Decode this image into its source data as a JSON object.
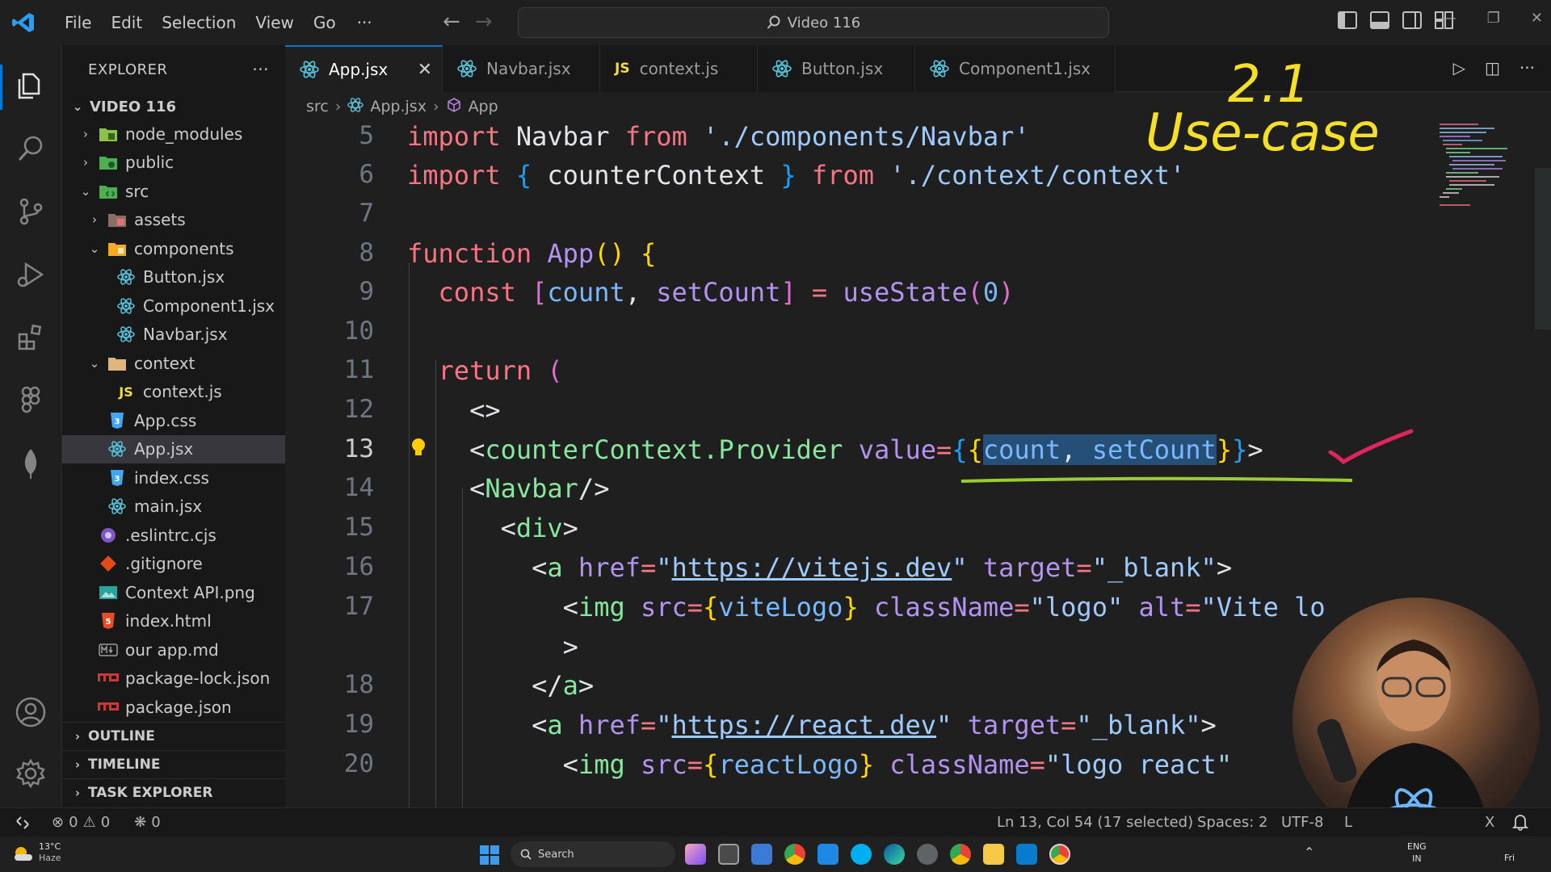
{
  "titlebar": {
    "menus": [
      "File",
      "Edit",
      "Selection",
      "View",
      "Go"
    ],
    "more": "···",
    "search_text": "Video 116"
  },
  "explorer": {
    "header": "EXPLORER",
    "more": "···",
    "root": "VIDEO 116",
    "items": [
      {
        "label": "node_modules",
        "icon": "folder-node-icon",
        "chev": "right"
      },
      {
        "label": "public",
        "icon": "folder-public-icon",
        "chev": "right"
      },
      {
        "label": "src",
        "icon": "folder-src-icon",
        "chev": "down"
      },
      {
        "label": "assets",
        "icon": "folder-assets-icon",
        "chev": "right"
      },
      {
        "label": "components",
        "icon": "folder-components-icon",
        "chev": "down"
      },
      {
        "label": "Button.jsx",
        "icon": "react-icon"
      },
      {
        "label": "Component1.jsx",
        "icon": "react-icon"
      },
      {
        "label": "Navbar.jsx",
        "icon": "react-icon"
      },
      {
        "label": "context",
        "icon": "folder-icon",
        "chev": "down"
      },
      {
        "label": "context.js",
        "icon": "js-icon"
      },
      {
        "label": "App.css",
        "icon": "css-icon"
      },
      {
        "label": "App.jsx",
        "icon": "react-icon",
        "selected": true
      },
      {
        "label": "index.css",
        "icon": "css-icon"
      },
      {
        "label": "main.jsx",
        "icon": "react-icon"
      },
      {
        "label": ".eslintrc.cjs",
        "icon": "eslint-icon"
      },
      {
        "label": ".gitignore",
        "icon": "git-icon"
      },
      {
        "label": "Context API.png",
        "icon": "image-icon"
      },
      {
        "label": "index.html",
        "icon": "html-icon"
      },
      {
        "label": "our app.md",
        "icon": "markdown-icon"
      },
      {
        "label": "package-lock.json",
        "icon": "npm-icon"
      },
      {
        "label": "package.json",
        "icon": "npm-icon"
      }
    ],
    "sections": [
      "OUTLINE",
      "TIMELINE",
      "TASK EXPLORER"
    ]
  },
  "tabs": [
    {
      "label": "App.jsx",
      "icon": "react-icon",
      "active": true
    },
    {
      "label": "Navbar.jsx",
      "icon": "react-icon"
    },
    {
      "label": "context.js",
      "icon": "js-icon"
    },
    {
      "label": "Button.jsx",
      "icon": "react-icon"
    },
    {
      "label": "Component1.jsx",
      "icon": "react-icon"
    }
  ],
  "breadcrumbs": {
    "folder": "src",
    "file": "App.jsx",
    "symbol": "App"
  },
  "editor": {
    "line_numbers": [
      "5",
      "6",
      "7",
      "8",
      "9",
      "10",
      "11",
      "12",
      "13",
      "14",
      "15",
      "16",
      "17",
      "",
      "18",
      "19",
      "20"
    ],
    "current_line": "13"
  },
  "annotation": {
    "line1": "2.1",
    "line2": "Use-case"
  },
  "statusbar": {
    "errors": "0",
    "warnings": "0",
    "ports": "0",
    "cursor": "Ln 13, Col 54 (17 selected)",
    "spaces": "Spaces: 2",
    "encoding": "UTF-8",
    "eol": "L",
    "lang": "X"
  },
  "taskbar": {
    "weather_temp": "13°C",
    "weather_desc": "Haze",
    "search": "Search",
    "lang1": "ENG",
    "lang2": "IN",
    "day": "Fri"
  },
  "colors": {
    "accent": "#0078d4",
    "annotation": "#f6e027",
    "checkmark": "#e0245e",
    "underline": "#9acd32"
  }
}
